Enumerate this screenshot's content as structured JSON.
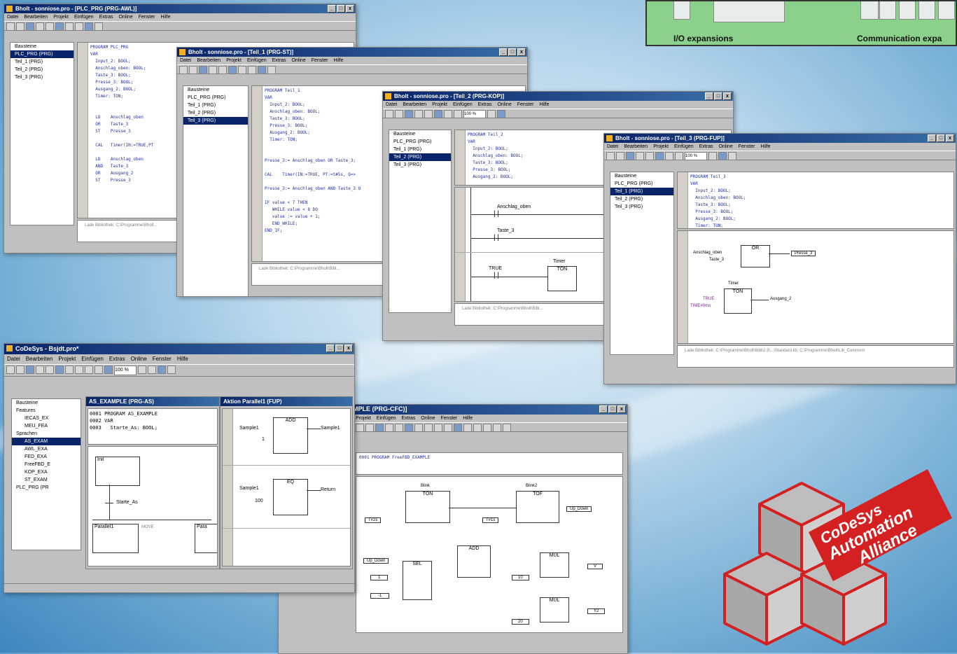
{
  "banner": {
    "io_label": "I/O expansions",
    "comm_label": "Communication expa"
  },
  "logo": {
    "line1": "CoDeSys",
    "line2": "Automation",
    "line3": "Alliance",
    "color": "#d42020"
  },
  "windows": {
    "win1": {
      "title": "Bholt - sonniose.pro - [PLC_PRG (PRG-AWL)]",
      "menu": [
        "Datei",
        "Bearbeiten",
        "Projekt",
        "Einfügen",
        "Extras",
        "Online",
        "Fenster",
        "Hilfe"
      ],
      "tree_header": "Bausteine",
      "tree_items": [
        "PLC_PRG (PRG)",
        "Teil_1 (PRG)",
        "Teil_2 (PRG)",
        "Teil_3 (PRG)"
      ],
      "code": "PROGRAM PLC_PRG\nVAR\n  Input_2: BOOL;\n  Anschlag_oben: BOOL;\n  Taste_3: BOOL;\n  Presse_3: BOOL;\n  Ausgang_2: BOOL;\n  Timer: TON;\n\n\n  LD    Anschlag_oben\n  OR    Taste_3\n  ST    Presse_3\n\n  CAL   Timer(IN:=TRUE,PT\n\n  LD    Anschlag_oben\n  AND   Taste_3\n  OR    Ausgang_2\n  ST    Presse_3",
      "status": "Lade Bibliothek: C:\\Programme\\Bholt..."
    },
    "win2": {
      "title": "Bholt - sonniose.pro - [Teil_1 (PRG-ST)]",
      "menu": [
        "Datei",
        "Bearbeiten",
        "Projekt",
        "Einfügen",
        "Extras",
        "Online",
        "Fenster",
        "Hilfe"
      ],
      "tree_header": "Bausteine",
      "tree_items": [
        "PLC_PRG (PRG)",
        "Teil_1 (PRG)",
        "Teil_2 (PRG)",
        "Teil_3 (PRG)"
      ],
      "code": "PROGRAM Teil_1\nVAR\n  Input_2: BOOL;\n  Anschlag_oben: BOOL;\n  Taste_3: BOOL;\n  Presse_3: BOOL;\n  Ausgang_2: BOOL;\n  Timer: TON;\n\n\nPresse_3:= Anschlag_oben OR Taste_3;\n\nCAL    Timer(IN:=TRUE, PT:=t#5s, Q=>\n\nPresse_3:= Anschlag_oben AND Taste_3 O\n\nIF value < 7 THEN\n   WHILE value < 8 DO\n   value := value + 1;\n   END_WHILE;\nEND_IF;",
      "status": "Lade Bibliothek: C:\\Programme\\Bholt\\Bibl..."
    },
    "win3": {
      "title": "Bholt - sonniose.pro - [Teil_2 (PRG-KOP)]",
      "menu": [
        "Datei",
        "Bearbeiten",
        "Projekt",
        "Einfügen",
        "Extras",
        "Online",
        "Fenster",
        "Hilfe"
      ],
      "zoom": "100 %",
      "tree_header": "Bausteine",
      "tree_items": [
        "PLC_PRG (PRG)",
        "Teil_1 (PRG)",
        "Teil_2 (PRG)",
        "Teil_3 (PRG)"
      ],
      "code": "PROGRAM Teil_2\nVAR\n  Input_2: BOOL;\n  Anschlag_oben: BOOL;\n  Taste_3: BOOL;\n  Presse_3: BOOL;\n  Ausgang_2: BOOL;",
      "contact1": "Anschlag_oben",
      "contact2": "Taste_3",
      "contact3": "TRUE",
      "timer_label": "Timer",
      "timer_type": "TON",
      "status": "Lade Bibliothek: C:\\Programme\\Bholt\\Bibl..."
    },
    "win4": {
      "title": "Bholt - sonniose.pro - [Teil_3 (PRG-FUP)]",
      "menu": [
        "Datei",
        "Bearbeiten",
        "Projekt",
        "Einfügen",
        "Extras",
        "Online",
        "Fenster",
        "Hilfe"
      ],
      "zoom": "100 %",
      "tree_header": "Bausteine",
      "tree_items": [
        "PLC_PRG (PRG)",
        "Teil_1 (PRG)",
        "Teil_2 (PRG)",
        "Teil_3 (PRG)"
      ],
      "code": "PROGRAM Teil_3\nVAR\n  Input_2: BOOL;\n  Anschlag_oben: BOOL;\n  Taste_3: BOOL;\n  Presse_3: BOOL;\n  Ausgang_2: BOOL;\n  Timer: TON;",
      "or_block": "OR",
      "or_in1": "Anschlag_oben",
      "or_in2": "Taste_3",
      "or_out": "Presse_3",
      "timer_label": "Timer",
      "timer_type": "TON",
      "timer_in": "TRUE",
      "timer_pt": "TIME#0ms",
      "timer_out": "Ausgang_2",
      "status": "Lade Bibliothek: C:\\Programme\\Bholt\\Bibl\\2.3\\...\\Standard.lib, C:\\Programme\\Bholt\\Lib_Common\\"
    },
    "win5": {
      "title": "CoDeSys - Bsjdt.pro*",
      "menu": [
        "Datei",
        "Bearbeiten",
        "Projekt",
        "Einfügen",
        "Extras",
        "Online",
        "Fenster",
        "Hilfe"
      ],
      "zoom": "100 %",
      "tree_header": "Bausteine",
      "tree_items": [
        "Features",
        "IECAS_EX",
        "MEU_FEA",
        "Sprachen",
        "AS_EXAM",
        "AWL_EXA",
        "FED_EXA",
        "FreeFBD_E",
        "KOP_EXA",
        "ST_EXAM",
        "PLC_PRG (PR"
      ],
      "sfc_title": "AS_EXAMPLE (PRG-AS)",
      "sfc_code": "0001 PROGRAM AS_EXAMPLE\n0002 VAR\n0003   Starte_As: BOOL;",
      "sfc_step1": "Init",
      "sfc_transition": "Starte_As",
      "sfc_step2": "Parallel1",
      "sfc_step3": "Para",
      "sfc_mid": "MOVE",
      "fup_title": "Aktion Parallel1 (FUP)",
      "add_block": "ADD",
      "add_in1": "Sample1",
      "add_in2": "1",
      "add_out": "Sample1",
      "eq_block": "EQ",
      "eq_in1": "Sample1",
      "eq_in2": "100",
      "eq_out": "Return"
    },
    "win6": {
      "title": "pro* - [FreeFBD_EXAMPLE (PRG-CFC)]",
      "menu": [
        "Projekt",
        "Einfügen",
        "Extras",
        "Online",
        "Fenster",
        "Hilfe"
      ],
      "code": "0001 PROGRAM FreeFBD_EXAMPLE",
      "blink1": "Blink",
      "blink1_type": "TON",
      "blink2": "Blink2",
      "blink2_type": "TOF",
      "t1": "T#2s",
      "t2": "T#1s",
      "up_down": "Up_Down",
      "sel": "SEL",
      "add": "ADD",
      "mul1": "MUL",
      "mul2": "MUL",
      "up_down2": "Up_Down",
      "c1": "1",
      "c2": "-1",
      "c10": "10",
      "c20": "20",
      "out_v": "V",
      "out_y2": "Y2"
    }
  }
}
